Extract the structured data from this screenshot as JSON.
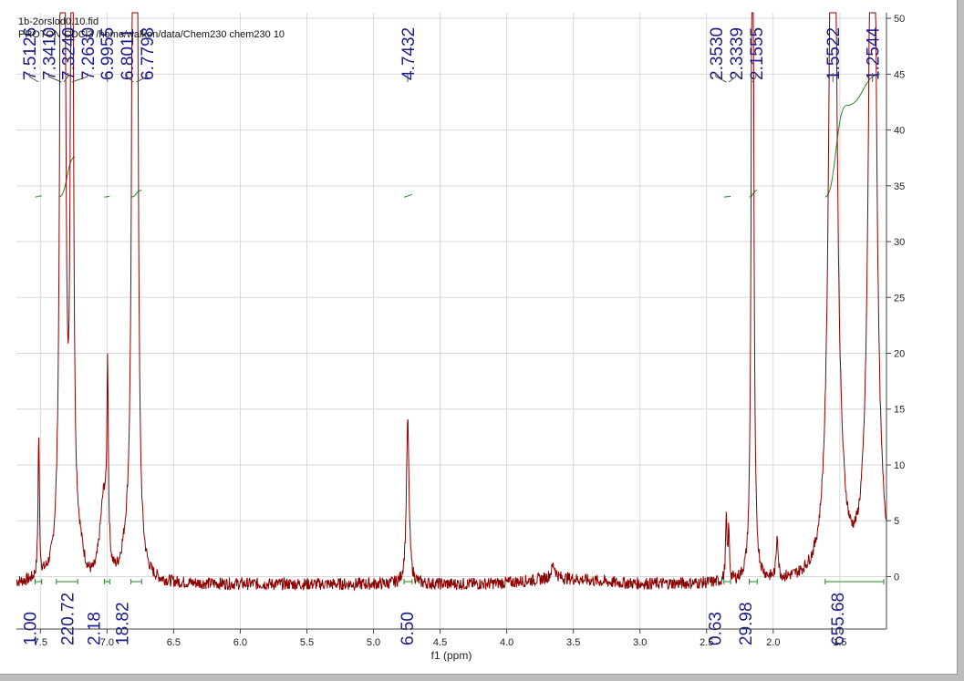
{
  "header": {
    "line1": "1b-2orslod0.10.fid",
    "line2": "PROTON CDCl3 /home/walkon/data/Chem230 chem230 10"
  },
  "chart_data": {
    "type": "line",
    "title": "",
    "xlabel": "f1 (ppm)",
    "ylabel": "",
    "xlim": [
      7.68,
      1.15
    ],
    "ylim": [
      -4.7,
      50.5
    ],
    "x_reversed": true,
    "grid": true,
    "x_ticks": [
      "7.5",
      "7.0",
      "6.5",
      "6.0",
      "5.5",
      "5.0",
      "4.5",
      "4.0",
      "3.5",
      "3.0",
      "2.5",
      "2.0",
      "1.5"
    ],
    "x_tick_values": [
      7.5,
      7.0,
      6.5,
      6.0,
      5.5,
      5.0,
      4.5,
      4.0,
      3.5,
      3.0,
      2.5,
      2.0,
      1.5
    ],
    "y_ticks": [
      "0",
      "5",
      "10",
      "15",
      "20",
      "25",
      "30",
      "35",
      "40",
      "45",
      "50"
    ],
    "y_tick_values": [
      0,
      5,
      10,
      15,
      20,
      25,
      30,
      35,
      40,
      45,
      50
    ],
    "series": [
      {
        "spectrum_peaks": [
          {
            "x": 7.5126,
            "h": 12.8,
            "w": 0.006
          },
          {
            "x": 7.341,
            "h": 100,
            "w": 0.01
          },
          {
            "x": 7.324,
            "h": 100,
            "w": 0.01
          },
          {
            "x": 7.263,
            "h": 100,
            "w": 0.009
          },
          {
            "x": 7.02,
            "h": 4.5,
            "w": 0.03
          },
          {
            "x": 6.9955,
            "h": 16.2,
            "w": 0.006
          },
          {
            "x": 6.8011,
            "h": 100,
            "w": 0.01
          },
          {
            "x": 6.7798,
            "h": 100,
            "w": 0.01
          },
          {
            "x": 4.7432,
            "h": 14.6,
            "w": 0.012
          },
          {
            "x": 3.65,
            "h": 1.2,
            "w": 0.02
          },
          {
            "x": 2.353,
            "h": 5.5,
            "w": 0.006
          },
          {
            "x": 2.3339,
            "h": 4.5,
            "w": 0.006
          },
          {
            "x": 2.1555,
            "h": 100,
            "w": 0.008
          },
          {
            "x": 1.97,
            "h": 4.0,
            "w": 0.008
          },
          {
            "x": 1.5522,
            "h": 100,
            "w": 0.025
          },
          {
            "x": 1.2544,
            "h": 100,
            "w": 0.025
          }
        ],
        "baseline": -0.7,
        "noise": 0.55,
        "values_note": ""
      }
    ],
    "peak_labels": [
      {
        "x": 7.5126,
        "label": "7.5126"
      },
      {
        "x": 7.341,
        "label": "7.3410"
      },
      {
        "x": 7.324,
        "label": "7.3240"
      },
      {
        "x": 7.263,
        "label": "7.2630"
      },
      {
        "x": 6.9955,
        "label": "6.9955"
      },
      {
        "x": 6.8011,
        "label": "6.8011"
      },
      {
        "x": 6.7798,
        "label": "6.7798"
      },
      {
        "x": 4.7432,
        "label": "4.7432"
      },
      {
        "x": 2.353,
        "label": "2.3530"
      },
      {
        "x": 2.3339,
        "label": "2.3339"
      },
      {
        "x": 2.1555,
        "label": "2.1555"
      },
      {
        "x": 1.5522,
        "label": "1.5522"
      },
      {
        "x": 1.2544,
        "label": "1.2544"
      }
    ],
    "integrals": [
      {
        "from": 7.54,
        "to": 7.49,
        "value": "1.00",
        "label_x": 7.58
      },
      {
        "from": 7.38,
        "to": 7.22,
        "value": "220.72",
        "label_x": 7.3
      },
      {
        "from": 7.02,
        "to": 6.98,
        "value": "2.18",
        "label_x": 7.1
      },
      {
        "from": 6.82,
        "to": 6.74,
        "value": "18.82",
        "label_x": 6.89
      },
      {
        "from": 4.77,
        "to": 4.71,
        "value": "6.50",
        "label_x": 4.75
      },
      {
        "from": 2.37,
        "to": 2.32,
        "value": "0.63",
        "label_x": 2.44
      },
      {
        "from": 2.18,
        "to": 2.12,
        "value": "29.98",
        "label_x": 2.21
      },
      {
        "from": 1.61,
        "to": 1.17,
        "value": "655.68",
        "label_x": 1.52
      }
    ],
    "integral_curves": [
      {
        "from": 7.54,
        "to": 7.49,
        "y0": 34.0,
        "y1": 34.1
      },
      {
        "from": 7.36,
        "to": 7.24,
        "y0": 34.0,
        "y1": 37.6
      },
      {
        "from": 7.02,
        "to": 6.98,
        "y0": 34.0,
        "y1": 34.05
      },
      {
        "from": 6.82,
        "to": 6.74,
        "y0": 34.0,
        "y1": 34.6
      },
      {
        "from": 4.77,
        "to": 4.71,
        "y0": 34.0,
        "y1": 34.2
      },
      {
        "from": 2.37,
        "to": 2.32,
        "y0": 34.0,
        "y1": 34.05
      },
      {
        "from": 2.18,
        "to": 2.12,
        "y0": 34.0,
        "y1": 34.6
      },
      {
        "from": 1.61,
        "to": 1.45,
        "y0": 34.0,
        "y1": 42.2
      },
      {
        "from": 1.45,
        "to": 1.2,
        "y0": 42.2,
        "y1": 45.0
      }
    ],
    "colors": {
      "spectrum": "#8b0000",
      "integral": "#1f8a1f",
      "labels": "#1c1c8c",
      "grid": "#d9d9d9"
    }
  }
}
